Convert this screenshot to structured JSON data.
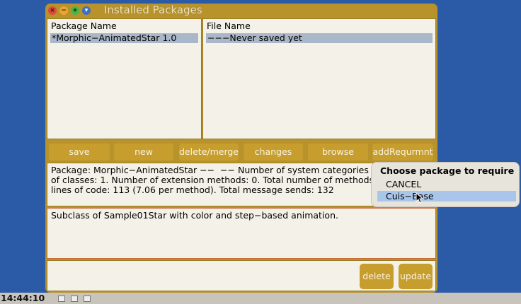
{
  "window": {
    "title": "Installed Packages",
    "package_column": {
      "header": "Package Name",
      "items": [
        "*Morphic−AnimatedStar 1.0"
      ]
    },
    "file_column": {
      "header": "File Name",
      "items": [
        "−−−Never saved yet"
      ]
    },
    "toolbar": {
      "save": "save",
      "new": "new",
      "delete_merge": "delete/merge",
      "changes": "changes",
      "browse": "browse",
      "add_requirement": "addRequrmnt"
    },
    "info": {
      "line1": "Package: Morphic−AnimatedStar −−  −− Number of system categories 1",
      "line2": "of classes: 1. Number of extension methods: 0. Total number of methods 1",
      "line3": "lines of code: 113 (7.06 per method). Total message sends: 132"
    },
    "description": "Subclass of Sample01Star with color and step−based animation.",
    "bottom": {
      "delete": "delete",
      "update": "update"
    }
  },
  "popup": {
    "title": "Choose package to require",
    "items": [
      "CANCEL",
      "Cuis−Base"
    ]
  },
  "taskbar": {
    "clock": "14:44:10"
  },
  "colors": {
    "desktop": "#2b5aa6",
    "window_frame": "#b8922a",
    "button": "#c79e2e",
    "selection": "#a9b7c8",
    "popup_selection": "#a9c6ea"
  }
}
